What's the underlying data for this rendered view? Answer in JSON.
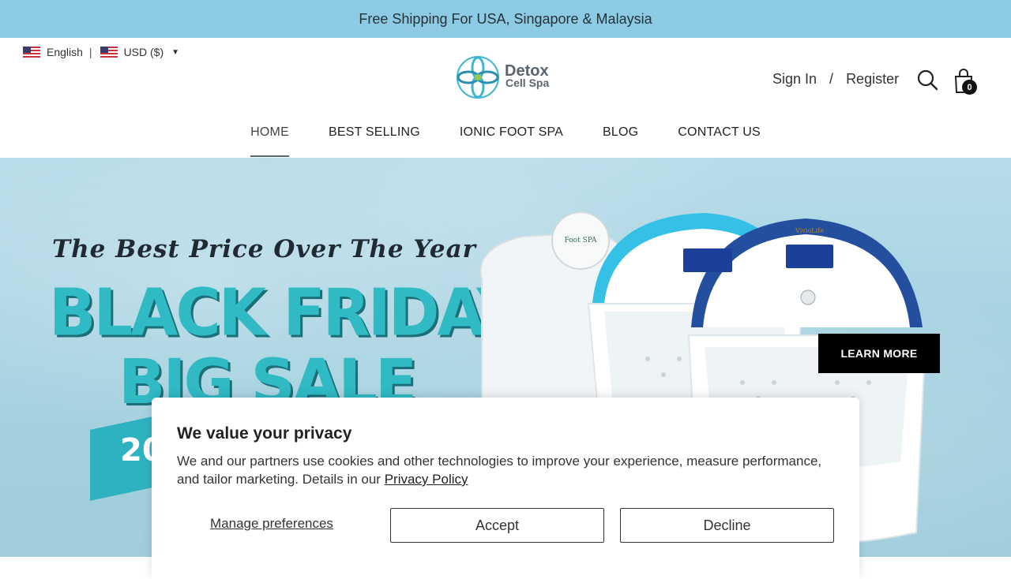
{
  "announcement": {
    "text": "Free Shipping For USA, Singapore & Malaysia"
  },
  "locale": {
    "language": "English",
    "currency": "USD ($)"
  },
  "logo": {
    "line1": "Detox",
    "line2": "Cell Spa"
  },
  "account": {
    "sign_in": "Sign In",
    "slash": "/",
    "register": "Register"
  },
  "cart": {
    "count": "0"
  },
  "nav": {
    "home": "HOME",
    "best_selling": "BEST SELLING",
    "ionic_foot_spa": "IONIC FOOT SPA",
    "blog": "BLOG",
    "contact_us": "CONTACT US"
  },
  "hero": {
    "tagline": "The Best Price Over The Year",
    "headline1": "BLACK FRIDAY",
    "headline2": "BIG SALE",
    "year_partial": "20",
    "button": "LEARN MORE",
    "product_labels": {
      "device_left": "Foot SPA",
      "device_right": "VivioLife"
    }
  },
  "cookie": {
    "title": "We value your privacy",
    "body": "We and our partners use cookies and other technologies to improve your experience, measure performance, and tailor marketing. Details in our",
    "policy_link": "Privacy Policy",
    "manage": "Manage preferences",
    "accept": "Accept",
    "decline": "Decline"
  },
  "colors": {
    "announcement_bg": "#8ccbe3",
    "accent_teal": "#2fbac4",
    "button_black": "#000000"
  }
}
